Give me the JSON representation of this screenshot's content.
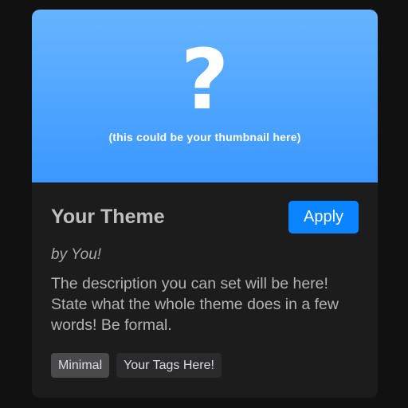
{
  "theme_card": {
    "thumbnail": {
      "icon": "question-mark-icon",
      "symbol": "?",
      "caption": "(this could be your thumbnail here)"
    },
    "title": "Your Theme",
    "apply_label": "Apply",
    "author": "by You!",
    "description": "The description you can set will be here! State what the whole theme does in a few words! Be formal.",
    "tags": [
      {
        "label": "Minimal"
      },
      {
        "label": "Your Tags Here!"
      }
    ]
  },
  "colors": {
    "page_background": "#111111",
    "card_background": "#1c1c1d",
    "thumbnail_gradient_top": "#66b4ff",
    "thumbnail_gradient_bottom": "#3b98ff",
    "accent": "#0a84ff",
    "title_text": "#bfbfbf",
    "body_text": "#b3b3b3"
  }
}
